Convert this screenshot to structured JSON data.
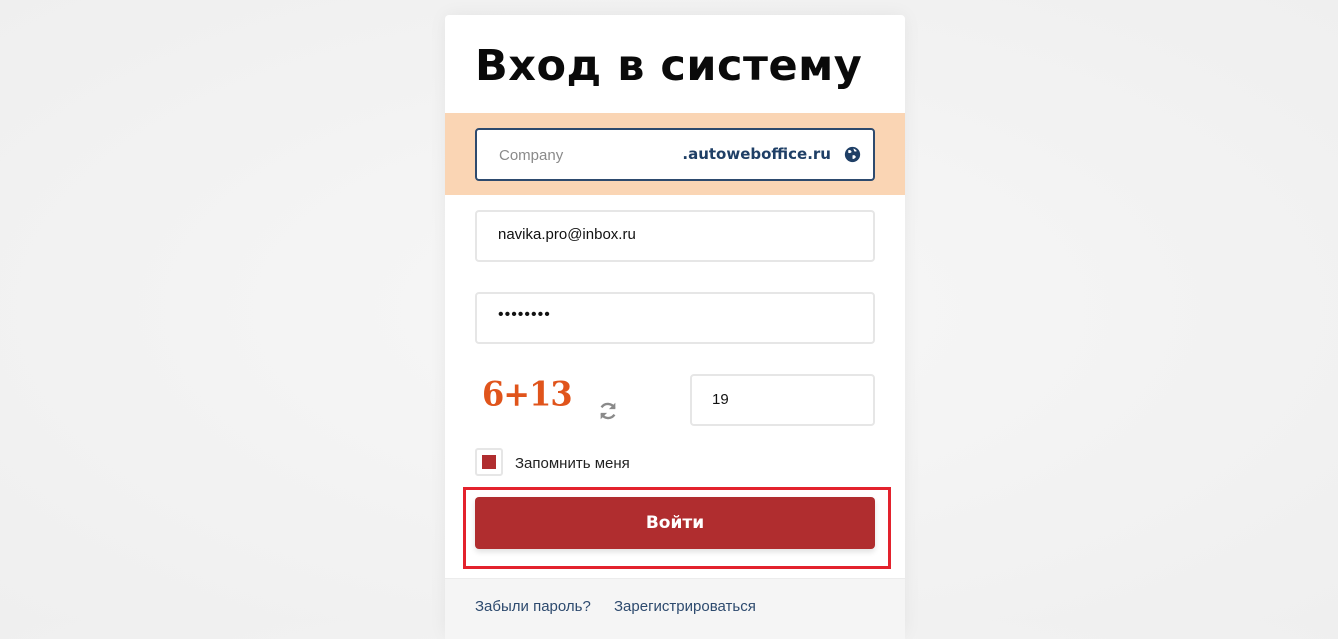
{
  "form": {
    "title": "Вход в систему",
    "company": {
      "placeholder": "Company",
      "domain_suffix": ".autoweboffice.ru",
      "globe_icon": "globe-icon"
    },
    "email": {
      "value": "navika.pro@inbox.ru"
    },
    "password": {
      "masked_value": "••••••••"
    },
    "captcha": {
      "expression": "6+13",
      "answer": "19",
      "refresh_icon": "refresh-icon"
    },
    "remember": {
      "label": "Запомнить меня",
      "checked": true
    },
    "submit_label": "Войти",
    "links": {
      "forgot": "Забыли пароль?",
      "register": "Зарегистрироваться"
    }
  },
  "colors": {
    "accent": "#b02d2f",
    "company_band": "#fad5b4",
    "domain_text": "#1f3f66",
    "captcha": "#e0541b",
    "highlight": "#e3222d"
  }
}
